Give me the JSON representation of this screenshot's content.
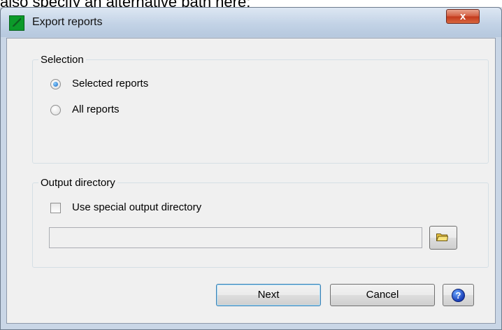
{
  "background_caption": "also specify an alternative path here:",
  "window": {
    "title": "Export reports",
    "close_glyph": "x",
    "app_icon": "green-document-icon"
  },
  "selection": {
    "legend": "Selection",
    "options": [
      {
        "label": "Selected reports",
        "checked": true
      },
      {
        "label": "All reports",
        "checked": false
      }
    ]
  },
  "output": {
    "legend": "Output directory",
    "checkbox_label": "Use special output directory",
    "checkbox_checked": false,
    "path_value": "",
    "browse_icon": "folder-open-icon"
  },
  "buttons": {
    "next": "Next",
    "cancel": "Cancel",
    "help_glyph": "?"
  }
}
